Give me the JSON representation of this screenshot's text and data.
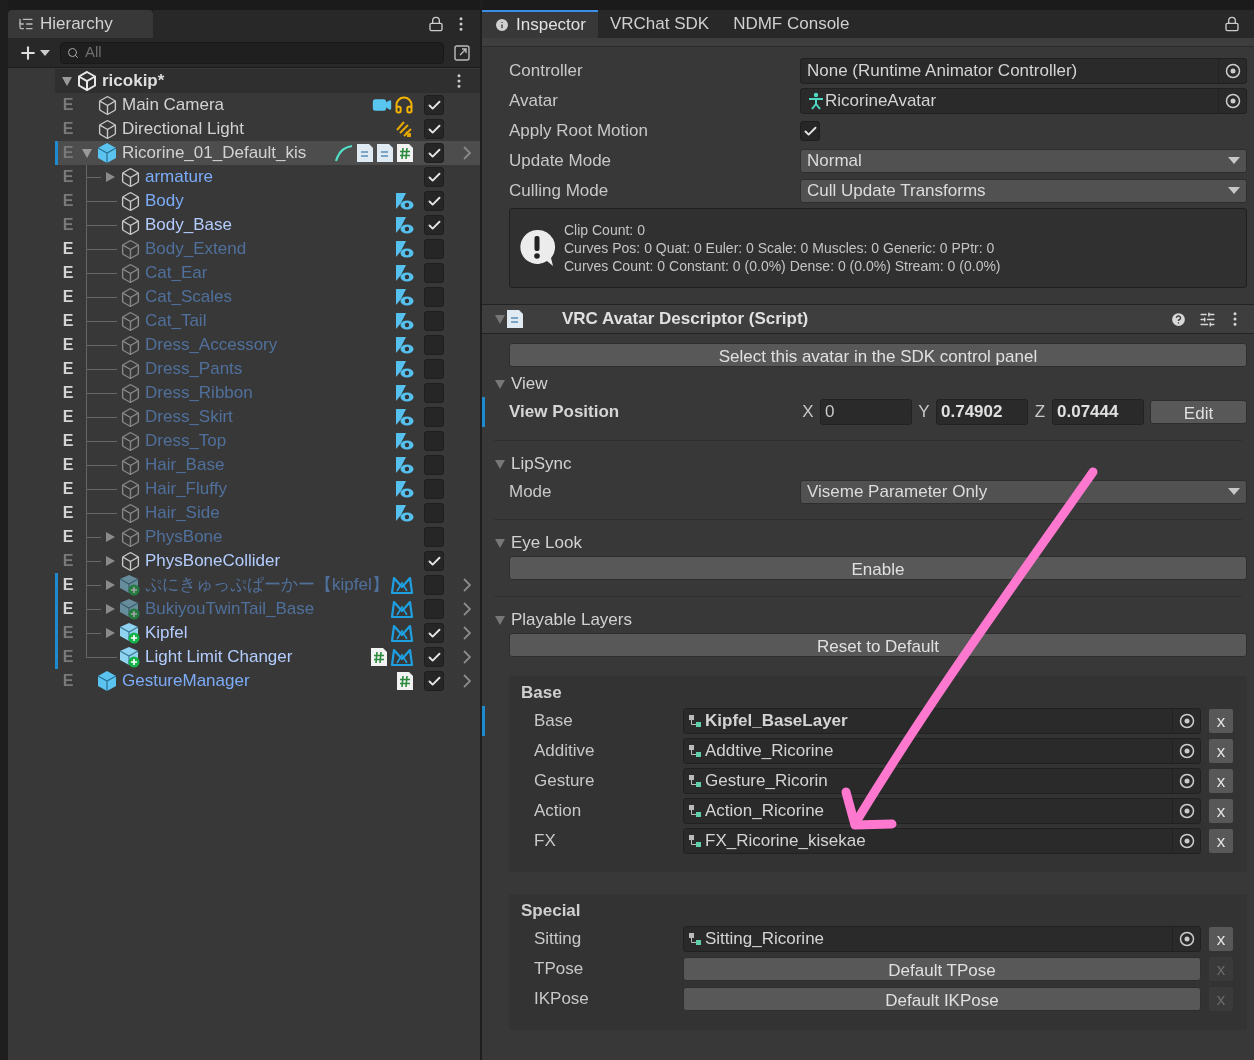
{
  "hierarchy": {
    "tab": "Hierarchy",
    "search": {
      "placeholder": "All"
    },
    "scene": {
      "name": "ricokip*",
      "expanded": true,
      "children": [
        {
          "name": "Main Camera",
          "kind": "camera",
          "in_prefab": false,
          "modified": false,
          "mark": "E",
          "checked": true,
          "selected": false,
          "overridden": false,
          "prefab_root": false
        },
        {
          "name": "Directional Light",
          "kind": "light",
          "in_prefab": false,
          "modified": false,
          "mark": "E",
          "checked": true,
          "selected": false,
          "overridden": false,
          "prefab_root": false
        },
        {
          "name": "Ricorine_01_Default_kis",
          "kind": "avatar",
          "in_prefab": false,
          "modified": false,
          "mark": "E",
          "checked": true,
          "selected": true,
          "overridden": true,
          "prefab_root": true,
          "expanded": true,
          "children": [
            {
              "name": "armature",
              "kind": "group",
              "in_prefab": true,
              "modified": false,
              "mark": "E",
              "checked": true,
              "selected": false,
              "overridden": false,
              "prefab_root": false,
              "expanded": false
            },
            {
              "name": "Body",
              "kind": "mesh",
              "in_prefab": true,
              "modified": false,
              "mark": "E",
              "checked": true,
              "selected": false,
              "overridden": false,
              "prefab_root": false
            },
            {
              "name": "Body_Base",
              "kind": "mesh",
              "in_prefab": true,
              "modified": true,
              "mark": "E",
              "checked": true,
              "selected": false,
              "overridden": false,
              "prefab_root": false
            },
            {
              "name": "Body_Extend",
              "kind": "mesh",
              "in_prefab": true,
              "modified": false,
              "mark": "E",
              "checked": false,
              "selected": false,
              "overridden": false,
              "prefab_root": false
            },
            {
              "name": "Cat_Ear",
              "kind": "mesh",
              "in_prefab": true,
              "modified": false,
              "mark": "E",
              "checked": false,
              "selected": false,
              "overridden": false,
              "prefab_root": false
            },
            {
              "name": "Cat_Scales",
              "kind": "mesh",
              "in_prefab": true,
              "modified": false,
              "mark": "E",
              "checked": false,
              "selected": false,
              "overridden": false,
              "prefab_root": false
            },
            {
              "name": "Cat_Tail",
              "kind": "mesh",
              "in_prefab": true,
              "modified": false,
              "mark": "E",
              "checked": false,
              "selected": false,
              "overridden": false,
              "prefab_root": false
            },
            {
              "name": "Dress_Accessory",
              "kind": "mesh",
              "in_prefab": true,
              "modified": false,
              "mark": "E",
              "checked": false,
              "selected": false,
              "overridden": false,
              "prefab_root": false
            },
            {
              "name": "Dress_Pants",
              "kind": "mesh",
              "in_prefab": true,
              "modified": false,
              "mark": "E",
              "checked": false,
              "selected": false,
              "overridden": false,
              "prefab_root": false
            },
            {
              "name": "Dress_Ribbon",
              "kind": "mesh",
              "in_prefab": true,
              "modified": false,
              "mark": "E",
              "checked": false,
              "selected": false,
              "overridden": false,
              "prefab_root": false
            },
            {
              "name": "Dress_Skirt",
              "kind": "mesh",
              "in_prefab": true,
              "modified": false,
              "mark": "E",
              "checked": false,
              "selected": false,
              "overridden": false,
              "prefab_root": false
            },
            {
              "name": "Dress_Top",
              "kind": "mesh",
              "in_prefab": true,
              "modified": false,
              "mark": "E",
              "checked": false,
              "selected": false,
              "overridden": false,
              "prefab_root": false
            },
            {
              "name": "Hair_Base",
              "kind": "mesh",
              "in_prefab": true,
              "modified": false,
              "mark": "E",
              "checked": false,
              "selected": false,
              "overridden": false,
              "prefab_root": false
            },
            {
              "name": "Hair_Fluffy",
              "kind": "mesh",
              "in_prefab": true,
              "modified": false,
              "mark": "E",
              "checked": false,
              "selected": false,
              "overridden": false,
              "prefab_root": false
            },
            {
              "name": "Hair_Side",
              "kind": "mesh",
              "in_prefab": true,
              "modified": false,
              "mark": "E",
              "checked": false,
              "selected": false,
              "overridden": false,
              "prefab_root": false
            },
            {
              "name": "PhysBone",
              "kind": "group",
              "in_prefab": true,
              "modified": false,
              "mark": "E",
              "checked": false,
              "selected": false,
              "overridden": false,
              "prefab_root": false,
              "expanded": false
            },
            {
              "name": "PhysBoneCollider",
              "kind": "group",
              "in_prefab": true,
              "modified": true,
              "mark": "E",
              "checked": true,
              "selected": false,
              "overridden": false,
              "prefab_root": false,
              "expanded": false
            },
            {
              "name": "ぷにきゅっぷぱーかー【kipfel】",
              "kind": "addon",
              "in_prefab": true,
              "modified": false,
              "mark": "E",
              "checked": false,
              "selected": false,
              "overridden": true,
              "prefab_root": true,
              "expanded": false
            },
            {
              "name": "BukiyouTwinTail_Base",
              "kind": "addon",
              "in_prefab": true,
              "modified": false,
              "mark": "E",
              "checked": false,
              "selected": false,
              "overridden": true,
              "prefab_root": true,
              "expanded": false
            },
            {
              "name": "Kipfel",
              "kind": "addon",
              "in_prefab": true,
              "modified": true,
              "mark": "E",
              "checked": true,
              "selected": false,
              "overridden": true,
              "prefab_root": true,
              "expanded": false
            },
            {
              "name": "Light Limit Changer",
              "kind": "addon_script",
              "in_prefab": true,
              "modified": true,
              "mark": "E",
              "checked": true,
              "selected": false,
              "overridden": true,
              "prefab_root": true
            }
          ]
        },
        {
          "name": "GestureManager",
          "kind": "tool",
          "in_prefab": true,
          "modified": false,
          "mark": "E",
          "checked": true,
          "selected": false,
          "overridden": false,
          "prefab_root": true
        }
      ]
    }
  },
  "inspector": {
    "tabs": [
      {
        "label": "Inspector",
        "selected": true
      },
      {
        "label": "VRChat SDK",
        "selected": false
      },
      {
        "label": "NDMF Console",
        "selected": false
      }
    ],
    "animator": {
      "fields": [
        {
          "kind": "object",
          "label": "Controller",
          "value": "None (Runtime Animator Controller)"
        },
        {
          "kind": "avatar",
          "label": "Avatar",
          "value": "RicorineAvatar"
        },
        {
          "kind": "checkbox",
          "label": "Apply Root Motion",
          "checked": true
        },
        {
          "kind": "dropdown",
          "label": "Update Mode",
          "value": "Normal"
        },
        {
          "kind": "dropdown",
          "label": "Culling Mode",
          "value": "Cull Update Transforms"
        }
      ],
      "info": [
        "Clip Count: 0",
        "Curves Pos: 0 Quat: 0 Euler: 0 Scale: 0 Muscles: 0 Generic: 0 PPtr: 0",
        "Curves Count: 0 Constant: 0 (0.0%) Dense: 0 (0.0%) Stream: 0 (0.0%)"
      ]
    },
    "descriptor": {
      "title": "VRC Avatar Descriptor (Script)",
      "expanded": true,
      "sdk_button": "Select this avatar in the SDK control panel",
      "view": {
        "title": "View",
        "expanded": true,
        "label": "View Position",
        "overridden": true,
        "axes": [
          {
            "axis": "X",
            "value": "0"
          },
          {
            "axis": "Y",
            "value": "0.74902"
          },
          {
            "axis": "Z",
            "value": "0.07444"
          }
        ],
        "edit_button": "Edit"
      },
      "lipsync": {
        "title": "LipSync",
        "expanded": true,
        "label": "Mode",
        "value": "Viseme Parameter Only"
      },
      "eye_look": {
        "title": "Eye Look",
        "expanded": true,
        "button": "Enable"
      },
      "playable_layers": {
        "title": "Playable Layers",
        "expanded": true,
        "button": "Reset to Default",
        "groups": [
          {
            "title": "Base",
            "layers": [
              {
                "kind": "object",
                "label": "Base",
                "value": "Kipfel_BaseLayer",
                "bold": true,
                "overridden": true,
                "clear": "x"
              },
              {
                "kind": "object",
                "label": "Additive",
                "value": "Addtive_Ricorine",
                "bold": false,
                "overridden": false,
                "clear": "x"
              },
              {
                "kind": "object",
                "label": "Gesture",
                "value": "Gesture_Ricorin",
                "bold": false,
                "overridden": false,
                "clear": "x"
              },
              {
                "kind": "object",
                "label": "Action",
                "value": "Action_Ricorine",
                "bold": false,
                "overridden": false,
                "clear": "x"
              },
              {
                "kind": "object",
                "label": "FX",
                "value": "FX_Ricorine_kisekae",
                "bold": false,
                "overridden": false,
                "clear": "x"
              }
            ]
          },
          {
            "title": "Special",
            "layers": [
              {
                "kind": "object",
                "label": "Sitting",
                "value": "Sitting_Ricorine",
                "bold": false,
                "overridden": false,
                "clear": "x"
              },
              {
                "kind": "default",
                "label": "TPose",
                "value": "Default TPose",
                "bold": false,
                "overridden": false,
                "clear": "x"
              },
              {
                "kind": "default",
                "label": "IKPose",
                "value": "Default IKPose",
                "bold": false,
                "overridden": false,
                "clear": "x"
              }
            ]
          }
        ]
      }
    }
  }
}
